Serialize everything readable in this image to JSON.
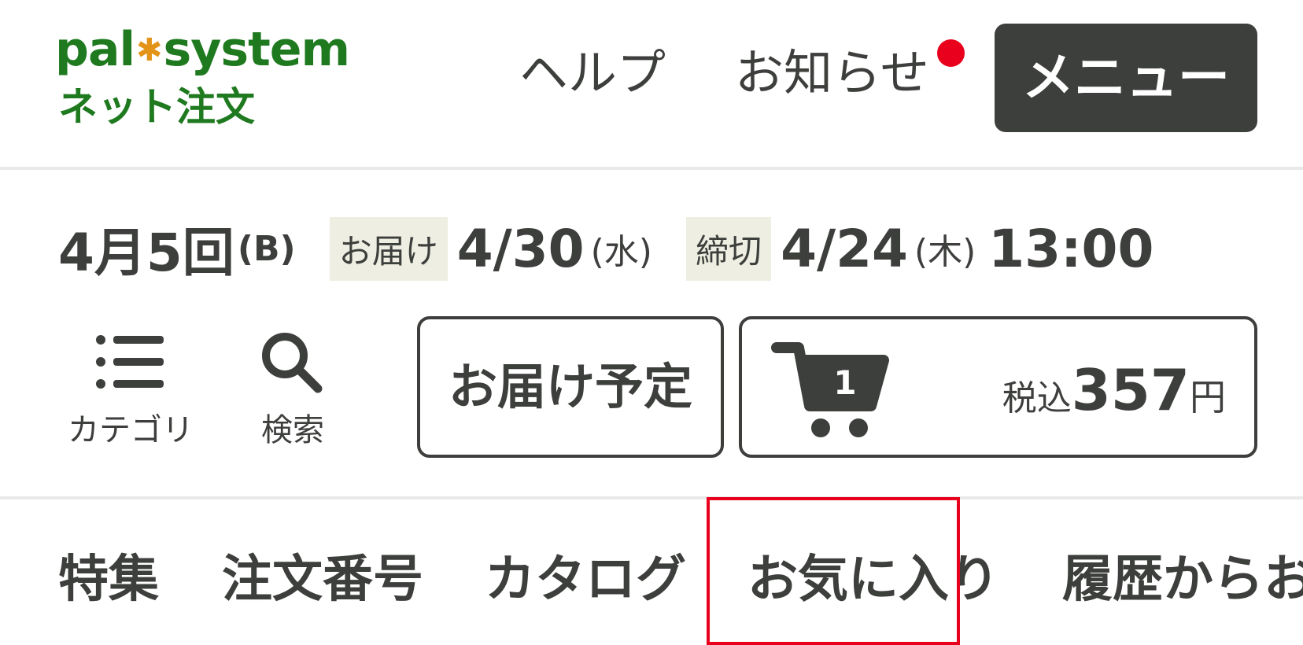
{
  "header": {
    "logo": {
      "word_left": "pal",
      "word_right": "system",
      "subtitle": "ネット注文"
    },
    "nav": {
      "help": "ヘルプ",
      "news": "お知らせ",
      "news_has_unread": true
    },
    "menu_label": "メニュー"
  },
  "delivery": {
    "round": "4月5回",
    "round_group": "(B)",
    "delivery_tag": "お届け",
    "delivery_date": "4/30",
    "delivery_dow": "(水)",
    "deadline_tag": "締切",
    "deadline_date": "4/24",
    "deadline_dow": "(木)",
    "deadline_time": "13:00"
  },
  "tools": {
    "category": {
      "label": "カテゴリ",
      "icon": "list-icon"
    },
    "search": {
      "label": "検索",
      "icon": "search-icon"
    },
    "schedule": "お届け予定",
    "cart": {
      "icon": "cart-icon",
      "count": "1",
      "tax_label": "税込",
      "amount": "357",
      "currency": "円"
    }
  },
  "tabs": [
    "特集",
    "注文番号",
    "カタログ",
    "お気に入り",
    "履歴からお"
  ],
  "highlighted_tab": "お気に入り",
  "colors": {
    "brand_green": "#1f7a1f",
    "logo_star": "#e39418",
    "dark": "#3d3f3c",
    "tag_bg": "#eeeee2",
    "alert_red": "#e8001c"
  }
}
